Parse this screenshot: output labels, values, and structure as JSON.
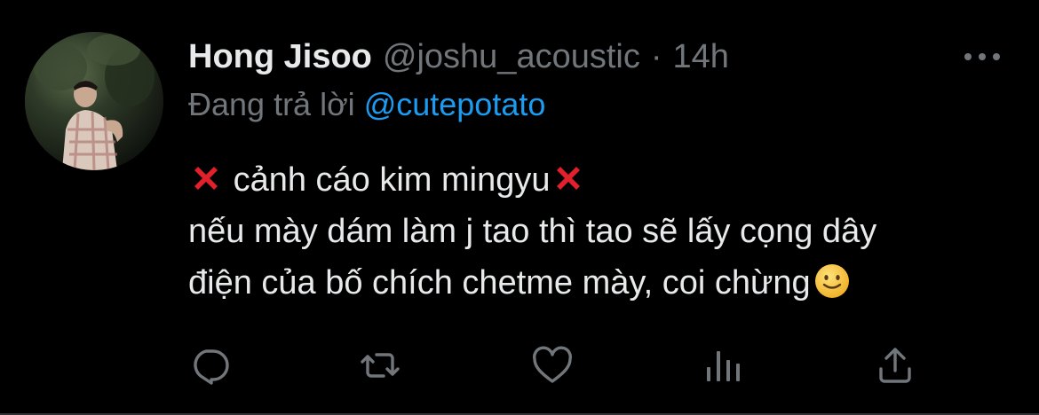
{
  "author": {
    "display_name": "Hong Jisoo",
    "handle": "@joshu_acoustic",
    "separator": "·",
    "time": "14h"
  },
  "reply": {
    "prefix": "Đang trả lời",
    "mention": "@cutepotato"
  },
  "content": {
    "line1": "cảnh cáo kim mingyu",
    "line2": "nếu mày dám làm j tao thì tao sẽ lấy cọng dây",
    "line3": "điện của bố chích chetme mày, coi chừng"
  },
  "icons": {
    "more": "more-horizontal-icon",
    "reply": "reply-icon",
    "retweet": "retweet-icon",
    "like": "heart-icon",
    "analytics": "analytics-icon",
    "share": "share-icon",
    "emoji_x": "cross-mark-emoji",
    "emoji_smile": "slightly-smiling-face-emoji"
  },
  "colors": {
    "background": "#000000",
    "text_primary": "#e7e9ea",
    "text_secondary": "#71767b",
    "link": "#1d9bf0",
    "cross_mark": "#e0202a",
    "smile_face": "#f5c33b"
  }
}
